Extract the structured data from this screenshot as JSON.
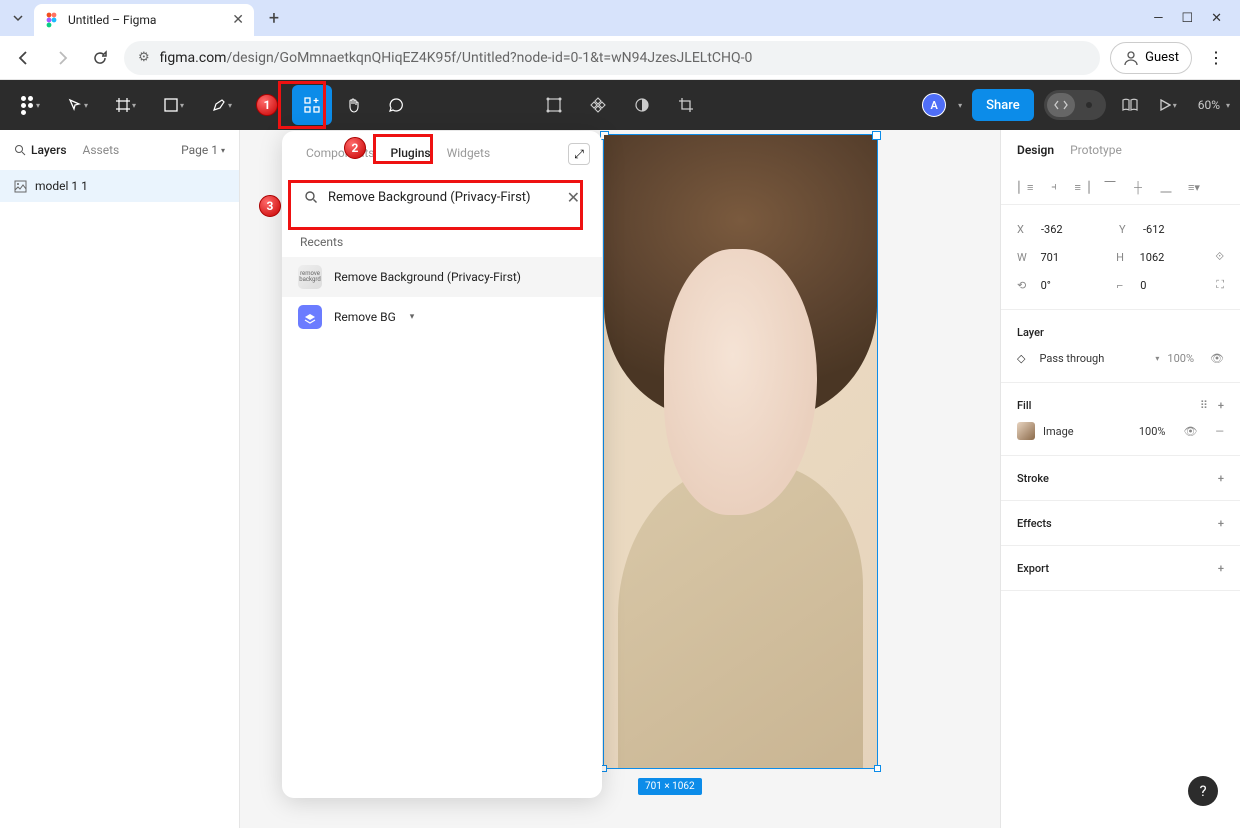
{
  "browser": {
    "tab_title": "Untitled – Figma",
    "url_domain": "figma.com",
    "url_path": "/design/GoMmnaetkqnQHiqEZ4K95f/Untitled?node-id=0-1&t=wN94JzesJLELtCHQ-0",
    "guest_label": "Guest"
  },
  "toolbar": {
    "avatar_initial": "A",
    "share_label": "Share",
    "zoom": "60%"
  },
  "left_panel": {
    "tab_layers": "Layers",
    "tab_assets": "Assets",
    "page_label": "Page 1",
    "layer_name": "model 1 1"
  },
  "resources": {
    "tab_components": "Components",
    "tab_plugins": "Plugins",
    "tab_widgets": "Widgets",
    "search_value": "Remove Background (Privacy-First)",
    "recents_label": "Recents",
    "items": [
      {
        "label": "Remove Background (Privacy-First)"
      },
      {
        "label": "Remove BG"
      }
    ]
  },
  "canvas": {
    "dim_badge": "701 × 1062"
  },
  "design": {
    "tab_design": "Design",
    "tab_prototype": "Prototype",
    "x_label": "X",
    "x_val": "-362",
    "y_label": "Y",
    "y_val": "-612",
    "w_label": "W",
    "w_val": "701",
    "h_label": "H",
    "h_val": "1062",
    "rot_label": "↳",
    "rot_val": "0°",
    "corner_val": "0",
    "layer_hdr": "Layer",
    "blend": "Pass through",
    "opacity": "100%",
    "fill_hdr": "Fill",
    "fill_type": "Image",
    "fill_opacity": "100%",
    "stroke_hdr": "Stroke",
    "effects_hdr": "Effects",
    "export_hdr": "Export"
  },
  "annotations": {
    "b1": "1",
    "b2": "2",
    "b3": "3"
  }
}
